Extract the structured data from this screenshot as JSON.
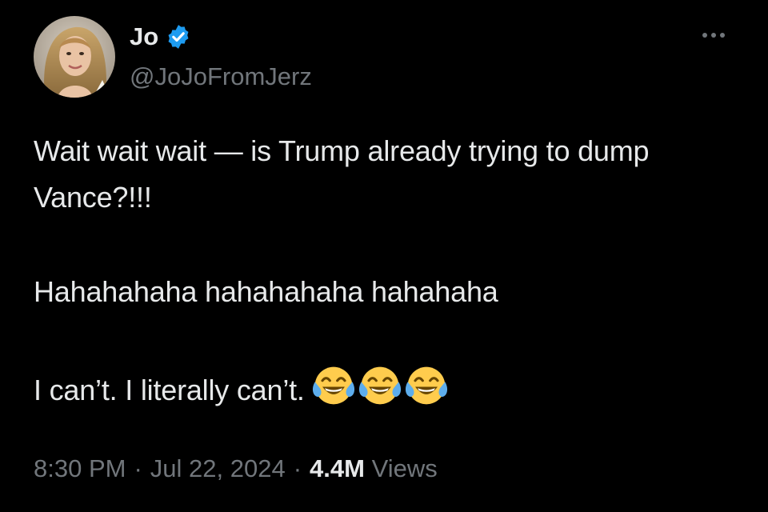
{
  "author": {
    "display_name": "Jo",
    "handle": "@JoJoFromJerz",
    "verified": true,
    "verified_color": "#1d9bf0",
    "avatar_icon": "profile-photo"
  },
  "more_icon": "ellipsis-icon",
  "tweet": {
    "line1": "Wait wait wait — is Trump already trying to dump Vance?!!!",
    "line2": "Hahahahaha hahahahaha hahahaha",
    "line3": "I can’t. I literally can’t.",
    "emojis": [
      "face-with-tears-of-joy",
      "face-with-tears-of-joy",
      "face-with-tears-of-joy"
    ]
  },
  "meta": {
    "time": "8:30 PM",
    "date": "Jul 22, 2024",
    "views_count": "4.4M",
    "views_label": "Views",
    "separator": "·"
  },
  "colors": {
    "background": "#000000",
    "primary_text": "#e7e9ea",
    "secondary_text": "#71767b"
  }
}
